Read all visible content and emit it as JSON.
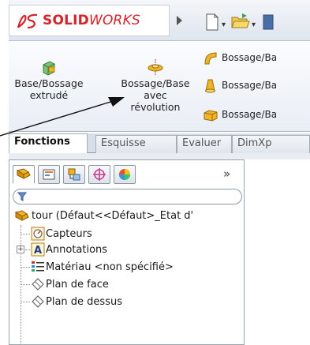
{
  "app": {
    "logo_brand": "SOLID",
    "logo_suffix": "WORKS"
  },
  "quick_access": {
    "icons": [
      "new-document-icon",
      "open-folder-icon"
    ]
  },
  "ribbon": {
    "extrude": {
      "label_line1": "Base/Bossage",
      "label_line2": "extrudé",
      "icon": "extrude-boss-icon"
    },
    "revolve": {
      "label_line1": "Bossage/Base",
      "label_line2": "avec",
      "label_line3": "révolution",
      "icon": "revolve-boss-icon"
    },
    "small_buttons": [
      {
        "label": "Bossage/Ba",
        "icon": "sweep-boss-icon"
      },
      {
        "label": "Bossage/Ba",
        "icon": "loft-boss-icon"
      },
      {
        "label": "Bossage/Ba",
        "icon": "boundary-boss-icon"
      }
    ]
  },
  "tabs": [
    {
      "label": "Fonctions",
      "active": true
    },
    {
      "label": "Esquisse",
      "active": false
    },
    {
      "label": "Evaluer",
      "active": false
    },
    {
      "label": "DimXp",
      "active": false
    }
  ],
  "panel": {
    "tab_icons": [
      "feature-manager-icon",
      "property-manager-icon",
      "configuration-manager-icon",
      "dimxpert-manager-icon",
      "display-manager-icon"
    ],
    "more_label": "»",
    "filter_icon": "filter-icon"
  },
  "tree": {
    "root_label": "tour  (Défaut<<Défaut>_Etat d'",
    "items": [
      {
        "label": "Capteurs",
        "icon": "sensors-icon",
        "expandable": false
      },
      {
        "label": "Annotations",
        "icon": "annotations-icon",
        "expandable": true
      },
      {
        "label": "Matériau <non spécifié>",
        "icon": "material-icon",
        "expandable": false
      },
      {
        "label": "Plan de face",
        "icon": "plane-icon",
        "expandable": false
      },
      {
        "label": "Plan de dessus",
        "icon": "plane-icon",
        "expandable": false
      }
    ]
  },
  "colors": {
    "brand_red": "#d5232b",
    "active_tab_bg": "#ffffff"
  }
}
